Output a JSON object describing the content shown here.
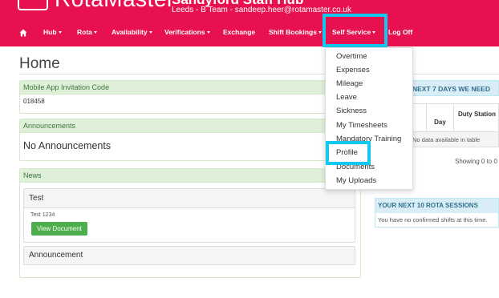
{
  "header": {
    "logo_text": "RotaMaster",
    "site_title": "Sandyford Staff Hub",
    "site_subtitle": "Leeds - B Team - sandeep.heer@rotamaster.co.uk"
  },
  "nav": {
    "items": [
      {
        "label": "Hub"
      },
      {
        "label": "Rota"
      },
      {
        "label": "Availability"
      },
      {
        "label": "Verifications"
      },
      {
        "label": "Exchange"
      },
      {
        "label": "Shift Bookings"
      },
      {
        "label": "Self Service"
      },
      {
        "label": "Log Off"
      }
    ]
  },
  "page": {
    "title": "Home"
  },
  "invitation": {
    "heading": "Mobile App Invitation Code",
    "code": "018458"
  },
  "announcements": {
    "heading": "Announcements",
    "text": "No Announcements"
  },
  "news": {
    "heading": "News",
    "test_title": "Test",
    "test_text": "Test 1234",
    "view_button": "View Document",
    "announcement_title": "Announcement"
  },
  "right": {
    "next7_heading": "NEXT 7 DAYS WE NEED",
    "col_day": "Day",
    "col_duty": "Duty Station",
    "no_data": "No data available in table",
    "showing": "Showing 0 to 0",
    "sessions_heading": "YOUR NEXT 10 ROTA SESSIONS",
    "sessions_text": "You have no confirmed shifts at this time."
  },
  "dropdown": {
    "items": [
      {
        "label": "Overtime"
      },
      {
        "label": "Expenses"
      },
      {
        "label": "Mileage"
      },
      {
        "label": "Leave"
      },
      {
        "label": "Sickness"
      },
      {
        "label": "My Timesheets"
      },
      {
        "label": "Mandatory Training"
      },
      {
        "label": "Profile"
      },
      {
        "label": "Documents"
      },
      {
        "label": "My Uploads"
      }
    ]
  },
  "colors": {
    "brand": "#e8114f",
    "highlight": "#11c9ef"
  }
}
